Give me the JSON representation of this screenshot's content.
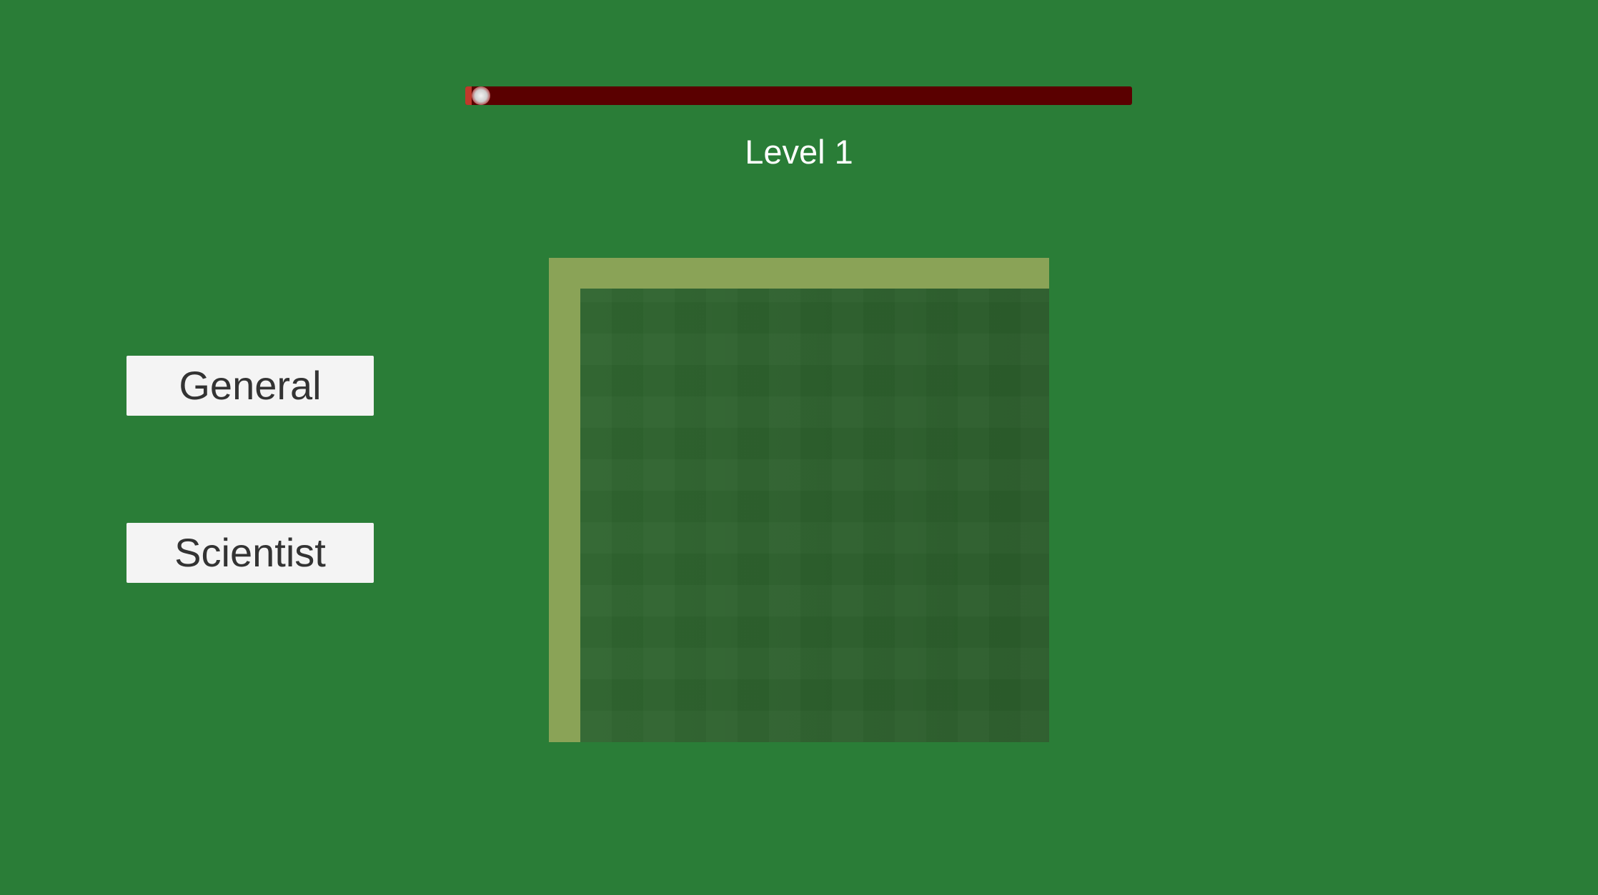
{
  "progress": {
    "value": 0.01
  },
  "level": {
    "label": "Level 1"
  },
  "menu": {
    "buttons": [
      {
        "label": "General"
      },
      {
        "label": "Scientist"
      }
    ]
  },
  "colors": {
    "background": "#2a7d37",
    "progress_track": "#5a0000",
    "panel_border": "#8aa357",
    "panel_inner": "#306630",
    "button_bg": "#f4f4f4",
    "button_text": "#333333"
  }
}
